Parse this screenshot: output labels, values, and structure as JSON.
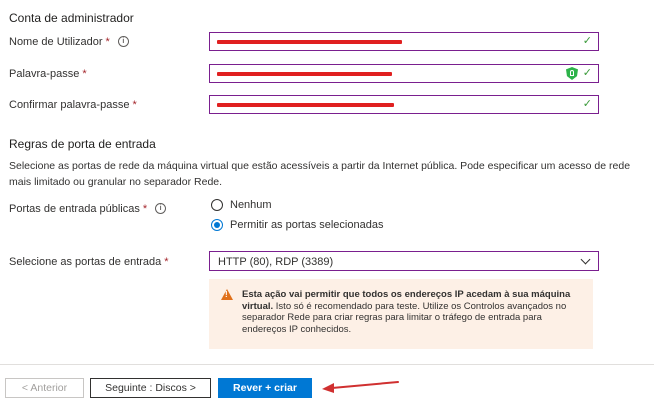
{
  "admin": {
    "heading": "Conta de administrador",
    "username_label": "Nome de Utilizador",
    "password_label": "Palavra-passe",
    "confirm_label": "Confirmar palavra-passe",
    "required_mark": "*"
  },
  "ports": {
    "heading": "Regras de porta de entrada",
    "description": "Selecione as portas de rede da máquina virtual que estão acessíveis a partir da Internet pública. Pode especificar um acesso de rede mais limitado ou granular no separador Rede.",
    "public_label": "Portas de entrada públicas",
    "radio_none": "Nenhum",
    "radio_allow": "Permitir as portas selecionadas",
    "select_label": "Selecione as portas de entrada",
    "select_value": "HTTP (80), RDP (3389)"
  },
  "warning": {
    "bold": "Esta ação vai permitir que todos os endereços IP acedam à sua máquina virtual.",
    "text": "Isto só é recomendado para teste.  Utilize os Controlos avançados no separador Rede para criar regras para limitar o tráfego de entrada para endereços IP conhecidos."
  },
  "footer": {
    "prev": "< Anterior",
    "next": "Seguinte : Discos >",
    "create": "Rever + criar"
  },
  "colors": {
    "accent": "#0078d4",
    "field_border": "#7a1f8f",
    "valid_check": "#3a9a3a",
    "redaction": "#e02020",
    "warning_bg": "#fdf0e6",
    "annotation_arrow": "#d03030"
  },
  "icons": [
    "info-icon",
    "check-icon",
    "password-shield-icon",
    "chevron-down-icon",
    "warning-icon",
    "arrow-annotation"
  ]
}
